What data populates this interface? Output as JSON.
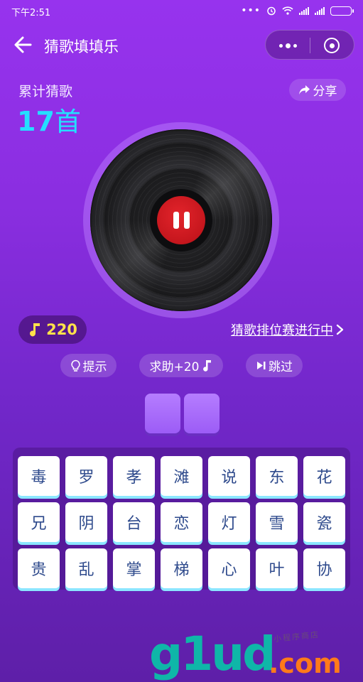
{
  "status": {
    "time": "下午2:51"
  },
  "nav": {
    "title": "猜歌填填乐"
  },
  "header": {
    "total_label": "累计猜歌",
    "total_number": "17",
    "total_unit": "首",
    "share_label": "分享"
  },
  "player": {
    "state": "playing",
    "pause_icon": "pause-icon"
  },
  "points": {
    "value": "220",
    "icon": "music-note-icon"
  },
  "rank_link": {
    "label": "猜歌排位赛进行中",
    "chevron": ">"
  },
  "actions": {
    "hint": "提示",
    "help": "求助+20",
    "skip": "跳过"
  },
  "answer_slots": [
    "",
    ""
  ],
  "keyboard": {
    "rows": [
      [
        "毒",
        "罗",
        "孝",
        "滩",
        "说",
        "东",
        "花"
      ],
      [
        "兄",
        "阴",
        "台",
        "恋",
        "灯",
        "雪",
        "瓷"
      ],
      [
        "贵",
        "乱",
        "掌",
        "梯",
        "心",
        "叶",
        "协"
      ]
    ]
  },
  "watermark": {
    "logo": "g1ud",
    "suffix": ".com",
    "sub": "小程序商店"
  },
  "colors": {
    "accent_cyan": "#24dfff",
    "points_yellow": "#ffe24a",
    "pause_red": "#c5161d",
    "key_text": "#2e4a8c"
  }
}
